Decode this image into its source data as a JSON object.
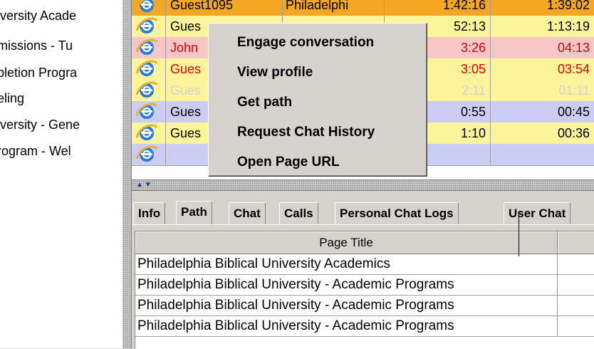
{
  "left_panel": {
    "items": [
      "iversity Acade",
      "missions - Tu",
      "pletion Progra",
      "eling",
      "iversity - Gene",
      "rogram - Wel"
    ]
  },
  "visitors": {
    "rows": [
      {
        "name": "Guest1095",
        "location": "Philadelphi",
        "time1": "1:42:16",
        "time2": "1:39:02",
        "bg": "#f5a623",
        "fg": "#000000"
      },
      {
        "name": "Gues",
        "location": "",
        "time1": "52:13",
        "time2": "1:13:19",
        "bg": "#fbf49a",
        "fg": "#000000"
      },
      {
        "name": "John",
        "location": "",
        "time1": "3:26",
        "time2": "04:13",
        "bg": "#f7c6c6",
        "fg": "#e00000"
      },
      {
        "name": "Gues",
        "location": "",
        "time1": "3:05",
        "time2": "03:54",
        "bg": "#fbf49a",
        "fg": "#e00000"
      },
      {
        "name": "Gues",
        "location": "",
        "time1": "2:11",
        "time2": "01:11",
        "bg": "#fbf49a",
        "fg": "#d6d3ce"
      },
      {
        "name": "Gues",
        "location": "",
        "time1": "0:55",
        "time2": "00:45",
        "bg": "#cccdf2",
        "fg": "#000000"
      },
      {
        "name": "Gues",
        "location": "",
        "time1": "1:10",
        "time2": "00:36",
        "bg": "#fbf49a",
        "fg": "#000000"
      },
      {
        "name": "",
        "location": "",
        "time1": "",
        "time2": "",
        "bg": "#cccdf2",
        "fg": "#000000"
      }
    ]
  },
  "context_menu": {
    "items": [
      "Engage conversation",
      "View profile",
      "Get path",
      "Request Chat History",
      "Open Page URL"
    ]
  },
  "tabs": [
    "Info",
    "Path",
    "Chat",
    "Calls",
    "Personal Chat Logs",
    "User Chat"
  ],
  "active_tab": "Path",
  "path_table": {
    "header": "Page Title",
    "rows": [
      "Philadelphia Biblical University Academics",
      "Philadelphia Biblical University - Academic Programs",
      "Philadelphia Biblical University - Academic Programs",
      "Philadelphia Biblical University - Academic Programs"
    ]
  },
  "icons": {
    "browser": "internet-explorer-icon",
    "split_arrows": "collapse-expand-arrows-icon"
  }
}
